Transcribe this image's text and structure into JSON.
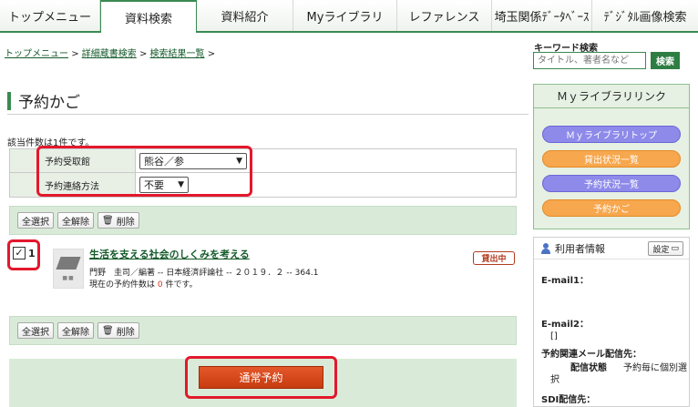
{
  "nav": {
    "tabs": [
      {
        "label": "トップメニュー"
      },
      {
        "label": "資料検索"
      },
      {
        "label": "資料紹介"
      },
      {
        "label": "Myライブラリ"
      },
      {
        "label": "レファレンス"
      },
      {
        "label": "埼玉関係ﾃﾞｰﾀﾍﾞｰｽ"
      },
      {
        "label": "ﾃﾞｼﾞﾀﾙ画像検索"
      }
    ],
    "active_index": 1
  },
  "breadcrumb": {
    "items": [
      "トップメニュー",
      "詳細蔵書検索",
      "検索結果一覧"
    ],
    "separator": ">"
  },
  "keyword_search": {
    "label": "キーワード検索",
    "placeholder": "タイトル、著者名など",
    "button_label": "検索"
  },
  "page_title": "予約かご",
  "count_text": "該当件数は1件です。",
  "form": {
    "pickup_label": "予約受取館",
    "pickup_value": "熊谷／参",
    "contact_label": "予約連絡方法",
    "contact_value": "不要"
  },
  "actions": {
    "select_all": "全選択",
    "deselect_all": "全解除",
    "delete": "削除"
  },
  "item": {
    "number": "1",
    "title": "生活を支える社会のしくみを考える",
    "meta": "門野　圭司／編著 -- 日本経済評論社 -- ２０１９．２ -- 364.1",
    "count_prefix": "現在の予約件数は ",
    "count_value": "0",
    "count_suffix": " 件です。",
    "status": "貸出中"
  },
  "reserve_button": "通常予約",
  "mylibrary_panel": {
    "title": "Ｍｙライブラリリンク",
    "links": [
      {
        "label": "Ｍｙライブラリトップ",
        "color": "#8e8aea"
      },
      {
        "label": "貸出状況一覧",
        "color": "#f7a74d"
      },
      {
        "label": "予約状況一覧",
        "color": "#8e8aea"
      },
      {
        "label": "予約かご",
        "color": "#f7a74d"
      }
    ]
  },
  "user_panel": {
    "title": "利用者情報",
    "settings_label": "設定",
    "email1_label": "E-mail1：",
    "email2_label": "E-mail2：",
    "email2_value": "[]",
    "notify_label": "予約関連メール配信先：",
    "delivery_state_label": "配信状態",
    "delivery_state_value_line1": "予約毎に個別選",
    "delivery_state_value_line2": "択",
    "sdi_label": "SDI配信先："
  }
}
